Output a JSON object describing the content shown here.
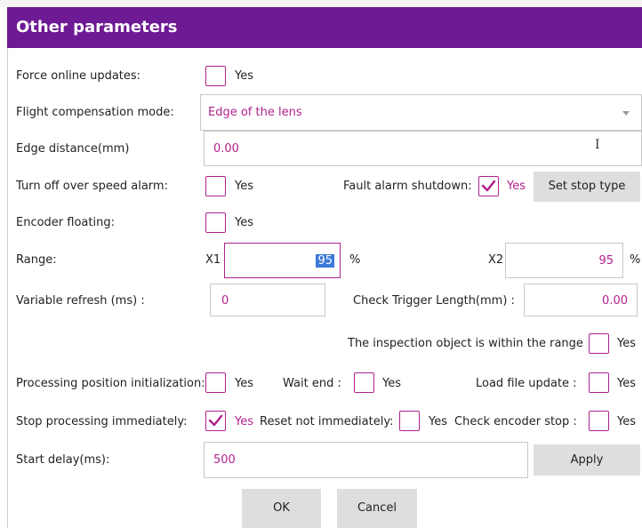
{
  "title": "Other parameters",
  "yes": "Yes",
  "force_online_updates": {
    "label": "Force online updates:",
    "checked": false
  },
  "flight_compensation_mode": {
    "label": "Flight compensation mode:",
    "value": "Edge of the lens"
  },
  "edge_distance": {
    "label": "Edge distance(mm)",
    "value": "0.00"
  },
  "turn_off_over_speed_alarm": {
    "label": "Turn off over speed alarm:",
    "checked": false
  },
  "fault_alarm_shutdown": {
    "label": "Fault alarm shutdown:",
    "checked": true
  },
  "set_stop_type_button": "Set stop type",
  "encoder_floating": {
    "label": "Encoder floating:",
    "checked": false
  },
  "range": {
    "label": "Range:",
    "x1_label": "X1",
    "x1_value": "95",
    "x2_label": "X2",
    "x2_value": "95",
    "unit": "%"
  },
  "variable_refresh": {
    "label": "Variable refresh (ms) :",
    "value": "0"
  },
  "check_trigger_length": {
    "label": "Check Trigger Length(mm) :",
    "value": "0.00"
  },
  "inspection_within_range": {
    "label": "The inspection object is within the range",
    "checked": false
  },
  "processing_position_initialization": {
    "label": "Processing position initialization:",
    "checked": false
  },
  "wait_end": {
    "label": "Wait end :",
    "checked": false
  },
  "load_file_update": {
    "label": "Load file update :",
    "checked": false
  },
  "stop_processing_immediately": {
    "label": "Stop processing immediately:",
    "checked": true
  },
  "reset_not_immediately": {
    "label": "Reset not immediately:",
    "checked": false
  },
  "check_encoder_stop": {
    "label": "Check encoder stop :",
    "checked": false
  },
  "start_delay": {
    "label": "Start delay(ms):",
    "value": "500"
  },
  "apply_button": "Apply",
  "ok_button": "OK",
  "cancel_button": "Cancel",
  "colors": {
    "title_bar": "#6e1a94",
    "accent": "#b0228c",
    "button": "#dedede",
    "selection": "#3b78d8"
  },
  "icons": {
    "dropdown": "chevron-down-icon",
    "check": "checkmark-icon",
    "cursor": "text-cursor-icon"
  }
}
